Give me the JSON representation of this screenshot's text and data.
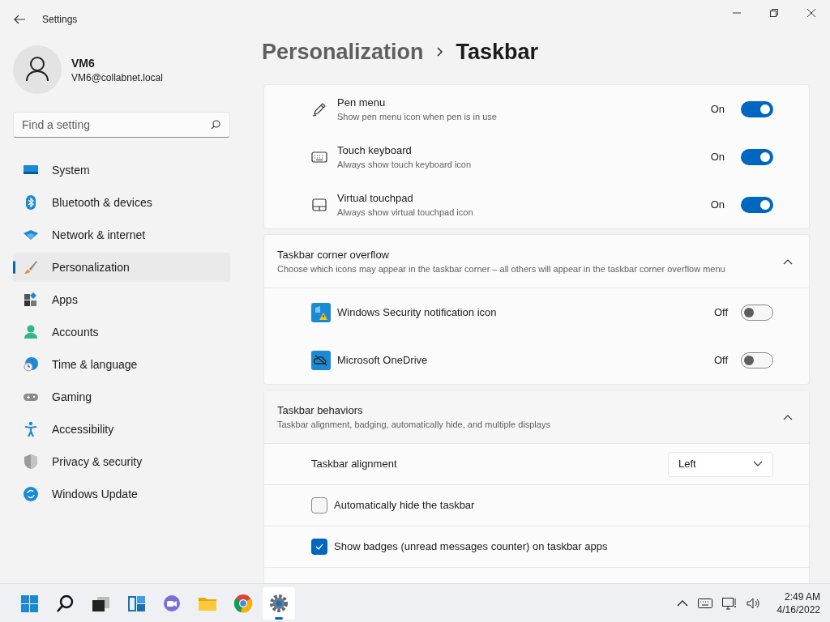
{
  "window": {
    "title": "Settings"
  },
  "user": {
    "name": "VM6",
    "email": "VM6@collabnet.local"
  },
  "search": {
    "placeholder": "Find a setting"
  },
  "nav": [
    {
      "label": "System",
      "kind": "system",
      "selected": false
    },
    {
      "label": "Bluetooth & devices",
      "kind": "bluetooth",
      "selected": false
    },
    {
      "label": "Network & internet",
      "kind": "network",
      "selected": false
    },
    {
      "label": "Personalization",
      "kind": "brush",
      "selected": true
    },
    {
      "label": "Apps",
      "kind": "apps",
      "selected": false
    },
    {
      "label": "Accounts",
      "kind": "accounts",
      "selected": false
    },
    {
      "label": "Time & language",
      "kind": "time",
      "selected": false
    },
    {
      "label": "Gaming",
      "kind": "gaming",
      "selected": false
    },
    {
      "label": "Accessibility",
      "kind": "accessibility",
      "selected": false
    },
    {
      "label": "Privacy & security",
      "kind": "shield",
      "selected": false
    },
    {
      "label": "Windows Update",
      "kind": "update",
      "selected": false
    }
  ],
  "breadcrumb": [
    "Personalization",
    "Taskbar"
  ],
  "pen_rows": [
    {
      "kind": "pen",
      "title": "Pen menu",
      "subtitle": "Show pen menu icon when pen is in use",
      "state": "On",
      "on": true
    },
    {
      "kind": "keyboard",
      "title": "Touch keyboard",
      "subtitle": "Always show touch keyboard icon",
      "state": "On",
      "on": true
    },
    {
      "kind": "touchpad",
      "title": "Virtual touchpad",
      "subtitle": "Always show virtual touchpad icon",
      "state": "On",
      "on": true
    }
  ],
  "overflow": {
    "title": "Taskbar corner overflow",
    "subtitle": "Choose which icons may appear in the taskbar corner – all others will appear in the taskbar corner overflow menu",
    "expanded": true,
    "items": [
      {
        "kind": "security",
        "title": "Windows Security notification icon",
        "state": "Off",
        "on": false
      },
      {
        "kind": "onedrive",
        "title": "Microsoft OneDrive",
        "state": "Off",
        "on": false
      }
    ]
  },
  "behaviors": {
    "title": "Taskbar behaviors",
    "subtitle": "Taskbar alignment, badging, automatically hide, and multiple displays",
    "expanded": true,
    "alignment": {
      "label": "Taskbar alignment",
      "value": "Left"
    },
    "options": [
      {
        "label": "Automatically hide the taskbar",
        "checked": false
      },
      {
        "label": "Show badges (unread messages counter) on taskbar apps",
        "checked": true
      }
    ]
  },
  "taskbar": {
    "apps": [
      {
        "kind": "start",
        "selected": false
      },
      {
        "kind": "search",
        "selected": false
      },
      {
        "kind": "taskview",
        "selected": false
      },
      {
        "kind": "widgets",
        "selected": false
      },
      {
        "kind": "chat",
        "selected": false
      },
      {
        "kind": "explorer",
        "selected": false
      },
      {
        "kind": "browser",
        "selected": false
      },
      {
        "kind": "settings",
        "selected": true
      }
    ],
    "time": "2:49 AM",
    "date": "4/16/2022"
  }
}
